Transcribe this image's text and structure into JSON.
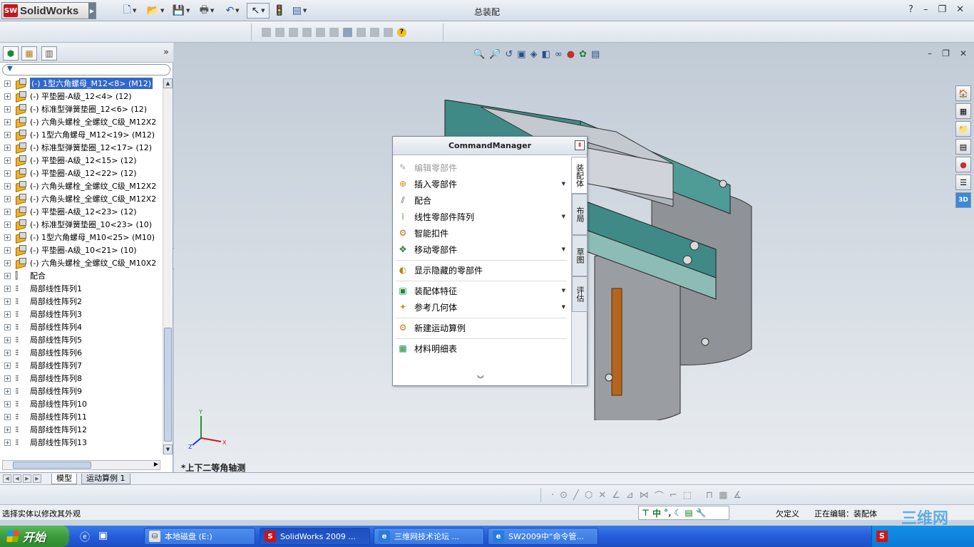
{
  "app": {
    "logo_text": "SolidWorks",
    "logo_mark": "SW",
    "document_title": "总装配"
  },
  "titlebar_controls": {
    "help": "?",
    "minimize": "–",
    "restore": "❐",
    "close": "✕"
  },
  "left_panel": {
    "expand_label": "»",
    "tree": [
      {
        "label": "(-) 1型六角螺母_M12<8> (M12)",
        "type": "part",
        "selected": true
      },
      {
        "label": "(-) 平垫圈-A级_12<4> (12)",
        "type": "part"
      },
      {
        "label": "(-) 标准型弹簧垫圈_12<6> (12)",
        "type": "part"
      },
      {
        "label": "(-) 六角头螺栓_全螺纹_C级_M12X2",
        "type": "part"
      },
      {
        "label": "(-) 1型六角螺母_M12<19> (M12)",
        "type": "part"
      },
      {
        "label": "(-) 标准型弹簧垫圈_12<17> (12)",
        "type": "part"
      },
      {
        "label": "(-) 平垫圈-A级_12<15> (12)",
        "type": "part"
      },
      {
        "label": "(-) 平垫圈-A级_12<22> (12)",
        "type": "part"
      },
      {
        "label": "(-) 六角头螺栓_全螺纹_C级_M12X2",
        "type": "part"
      },
      {
        "label": "(-) 六角头螺栓_全螺纹_C级_M12X2",
        "type": "part"
      },
      {
        "label": "(-) 平垫圈-A级_12<23> (12)",
        "type": "part"
      },
      {
        "label": "(-) 标准型弹簧垫圈_10<23> (10)",
        "type": "part"
      },
      {
        "label": "(-) 1型六角螺母_M10<25> (M10)",
        "type": "part"
      },
      {
        "label": "(-) 平垫圈-A级_10<21> (10)",
        "type": "part"
      },
      {
        "label": "(-) 六角头螺栓_全螺纹_C级_M10X2",
        "type": "part"
      },
      {
        "label": "配合",
        "type": "mate"
      },
      {
        "label": "局部线性阵列1",
        "type": "pattern"
      },
      {
        "label": "局部线性阵列2",
        "type": "pattern"
      },
      {
        "label": "局部线性阵列3",
        "type": "pattern"
      },
      {
        "label": "局部线性阵列4",
        "type": "pattern"
      },
      {
        "label": "局部线性阵列5",
        "type": "pattern"
      },
      {
        "label": "局部线性阵列6",
        "type": "pattern"
      },
      {
        "label": "局部线性阵列7",
        "type": "pattern"
      },
      {
        "label": "局部线性阵列8",
        "type": "pattern"
      },
      {
        "label": "局部线性阵列9",
        "type": "pattern"
      },
      {
        "label": "局部线性阵列10",
        "type": "pattern"
      },
      {
        "label": "局部线性阵列11",
        "type": "pattern"
      },
      {
        "label": "局部线性阵列12",
        "type": "pattern"
      },
      {
        "label": "局部线性阵列13",
        "type": "pattern"
      }
    ]
  },
  "command_manager": {
    "title": "CommandManager",
    "items": [
      {
        "label": "编辑零部件",
        "icon": "edit-component-icon",
        "disabled": true,
        "dropdown": false
      },
      {
        "label": "插入零部件",
        "icon": "insert-component-icon",
        "disabled": false,
        "dropdown": true
      },
      {
        "label": "配合",
        "icon": "mate-icon",
        "disabled": false,
        "dropdown": false
      },
      {
        "label": "线性零部件阵列",
        "icon": "linear-pattern-icon",
        "disabled": false,
        "dropdown": true
      },
      {
        "label": "智能扣件",
        "icon": "smart-fastener-icon",
        "disabled": false,
        "dropdown": false
      },
      {
        "label": "移动零部件",
        "icon": "move-component-icon",
        "disabled": false,
        "dropdown": true
      },
      {
        "label": "显示隐藏的零部件",
        "icon": "show-hidden-icon",
        "disabled": false,
        "dropdown": false,
        "sep_before": true
      },
      {
        "label": "装配体特征",
        "icon": "assembly-feature-icon",
        "disabled": false,
        "dropdown": true,
        "sep_before": true
      },
      {
        "label": "参考几何体",
        "icon": "reference-geometry-icon",
        "disabled": false,
        "dropdown": true
      },
      {
        "label": "新建运动算例",
        "icon": "motion-study-icon",
        "disabled": false,
        "dropdown": false,
        "sep_before": true
      },
      {
        "label": "材料明细表",
        "icon": "bom-icon",
        "disabled": false,
        "dropdown": false,
        "sep_before": true
      }
    ],
    "more_label": "︾",
    "tabs": [
      {
        "label": "装配体",
        "active": true
      },
      {
        "label": "布局",
        "active": false
      },
      {
        "label": "草图",
        "active": false
      },
      {
        "label": "评估",
        "active": false
      }
    ]
  },
  "viewport": {
    "view_name": "*上下二等角轴测",
    "triad": {
      "x": "X",
      "y": "Y",
      "z": "Z"
    }
  },
  "bottom_tabs": {
    "model": "模型",
    "motion_study": "运动算例 1"
  },
  "status": {
    "hint": "选择实体以修改其外观",
    "ime_label": "中",
    "definition": "欠定义",
    "editing": "正在编辑：装配体"
  },
  "taskbar": {
    "start_label": "开始",
    "items": [
      {
        "label": "本地磁盘 (E:)",
        "icon": "drive-icon"
      },
      {
        "label": "SolidWorks 2009 ...",
        "icon": "solidworks-icon",
        "active": true
      },
      {
        "label": "三维网技术论坛 ...",
        "icon": "ie-icon"
      },
      {
        "label": "SW2009中“命令管...",
        "icon": "ie-icon"
      }
    ],
    "tray_s": "S"
  },
  "colors": {
    "accent": "#3168c8",
    "taskbar": "#245edb",
    "start": "#3c9c3c",
    "model_teal": "#3f8a86",
    "model_gray": "#8f9296"
  }
}
